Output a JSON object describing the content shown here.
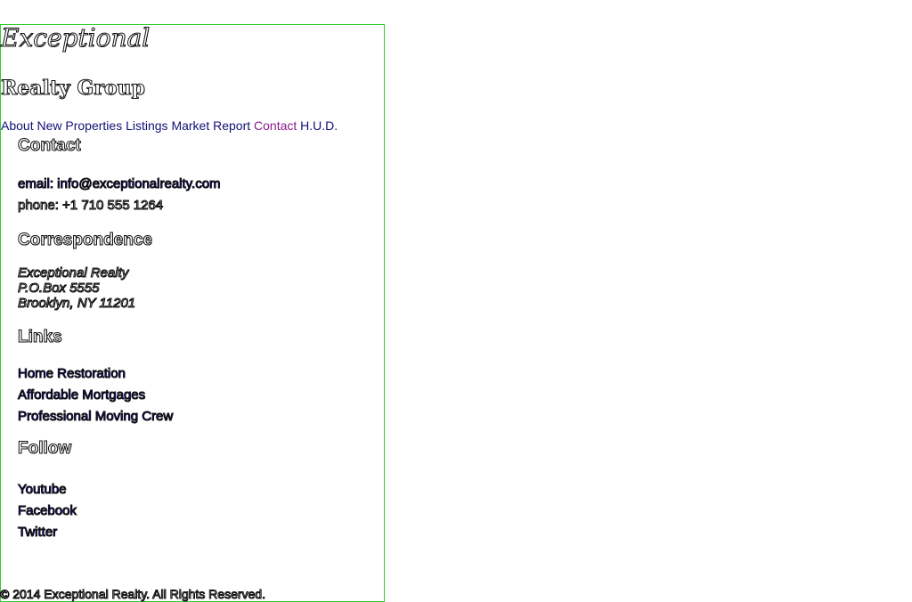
{
  "brand": {
    "name_script": "Exceptional",
    "name_group": "Realty Group"
  },
  "nav": {
    "items": [
      "About",
      "New Properties",
      "Listings",
      "Market Report",
      "Contact",
      "H.U.D."
    ]
  },
  "contact": {
    "title": "Contact",
    "email": "email: info@exceptionalrealty.com",
    "phone": "phone: +1 710 555 1264"
  },
  "correspondence": {
    "title": "Correspondence",
    "lines": [
      "Exceptional Realty",
      "P.O.Box 5555",
      "Brooklyn, NY 11201"
    ]
  },
  "links": {
    "title": "Links",
    "items": [
      "Home Restoration",
      "Affordable Mortgages",
      "Professional Moving Crew"
    ]
  },
  "follow": {
    "title": "Follow",
    "items": [
      "Youtube",
      "Facebook",
      "Twitter"
    ]
  },
  "footer": {
    "copyright": "© 2014 Exceptional Realty. All Rights Reserved."
  },
  "colors": {
    "frame_border": "#33cc33",
    "nav_link": "#111177",
    "nav_link_visited": "#8a1a8a"
  }
}
